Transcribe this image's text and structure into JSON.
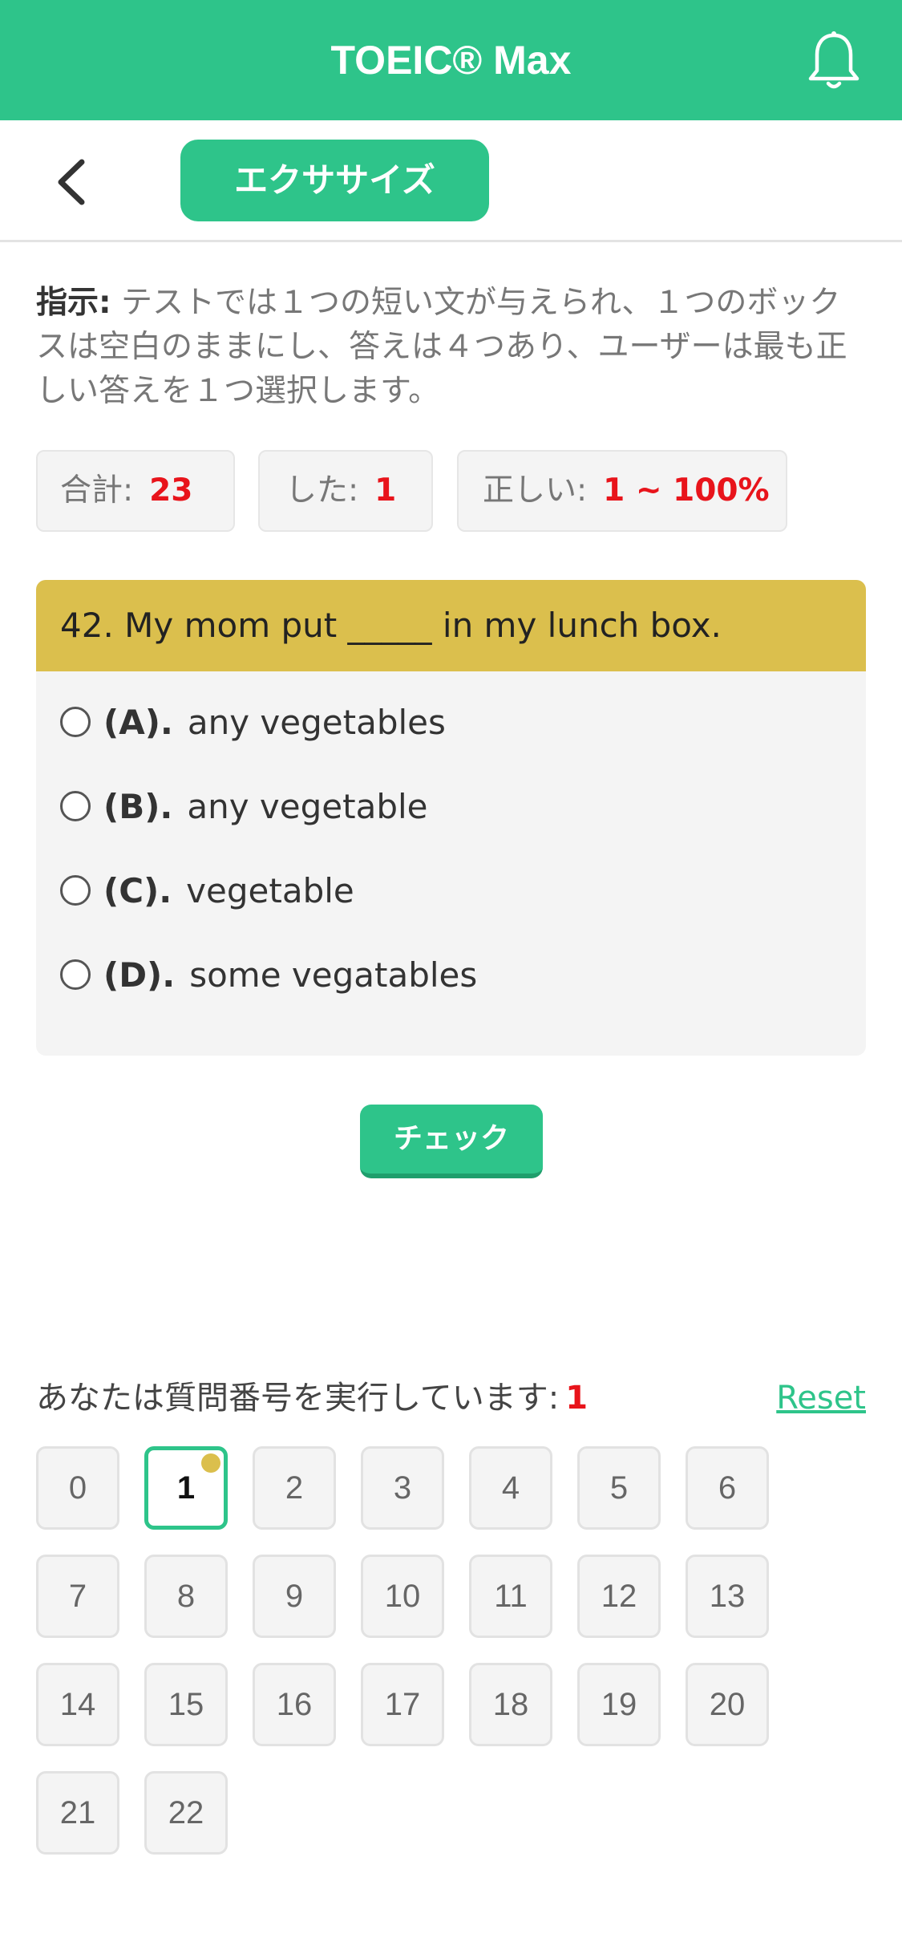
{
  "header": {
    "title": "TOEIC® Max",
    "bell_icon": "bell-icon"
  },
  "subheader": {
    "back_icon": "chevron-left-icon",
    "section_label": "エクササイズ"
  },
  "instruction": {
    "label": "指示:",
    "text": " テストでは１つの短い文が与えられ、１つのボックスは空白のままにし、答えは４つあり、ユーザーは最も正しい答えを１つ選択します。"
  },
  "stats": {
    "total_label": "合計:",
    "total_value": "23",
    "done_label": "した:",
    "done_value": "1",
    "correct_label": "正しい:",
    "correct_value": "1 ~ 100%"
  },
  "question": {
    "text": "42. My mom put _____ in my lunch box.",
    "options": [
      {
        "letter": "(A).",
        "text": "any vegetables"
      },
      {
        "letter": "(B).",
        "text": "any vegetable"
      },
      {
        "letter": "(C).",
        "text": "vegetable"
      },
      {
        "letter": "(D).",
        "text": "some vegatables"
      }
    ]
  },
  "check_button": "チェック",
  "progress": {
    "label": "あなたは質問番号を実行しています:",
    "current": "1",
    "reset": "Reset"
  },
  "question_numbers": [
    "0",
    "1",
    "2",
    "3",
    "4",
    "5",
    "6",
    "7",
    "8",
    "9",
    "10",
    "11",
    "12",
    "13",
    "14",
    "15",
    "16",
    "17",
    "18",
    "19",
    "20",
    "21",
    "22"
  ],
  "colors": {
    "primary": "#2ec48a",
    "question_header": "#dbbf4d",
    "highlight": "#e8141b"
  }
}
